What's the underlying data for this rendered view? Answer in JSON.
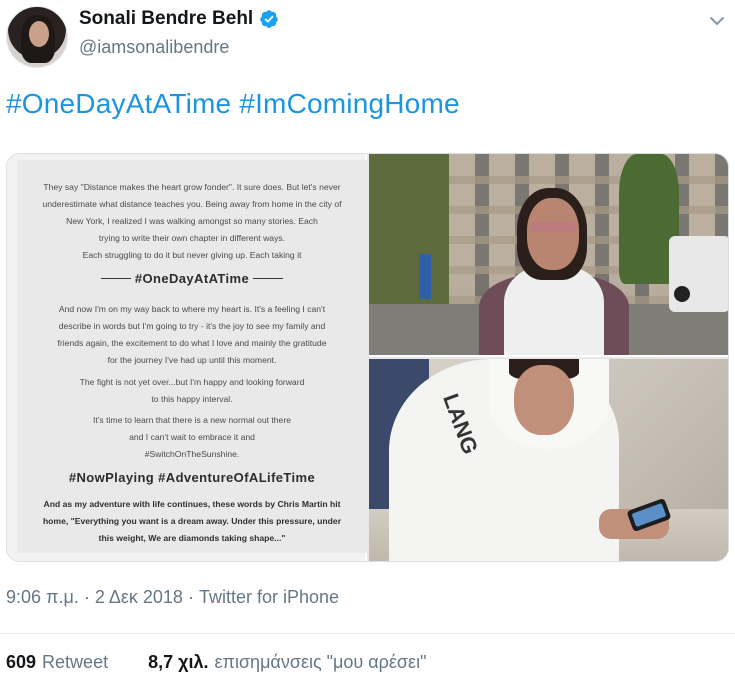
{
  "author": {
    "display_name": "Sonali Bendre Behl",
    "handle": "@iamsonalibendre"
  },
  "tweet": {
    "text": "#OneDayAtATime #ImComingHome",
    "timestamp": "9:06 π.μ.",
    "date": "2 Δεκ 2018",
    "source": "Twitter for iPhone",
    "separator": " · "
  },
  "image_text": {
    "para1": [
      "They say \"Distance makes the heart grow fonder\". It sure does. But let's never",
      "underestimate what distance teaches you. Being away from home in the city of",
      "New York, I realized I was walking amongst so many stories. Each",
      "trying to write their own chapter in different ways.",
      "Each struggling to do it but never giving up. Each taking it"
    ],
    "heading1": "#OneDayAtATime",
    "para2": [
      "And now I'm on my way back to where my heart is. It's a feeling I can't",
      "describe in words but I'm going to try - it's the joy to see my family and",
      "friends again, the excitement to do what I love and mainly the gratitude",
      "for the journey I've had up until this moment."
    ],
    "para3": [
      "The fight is not yet over...but I'm happy and looking forward",
      "to this happy interval."
    ],
    "para4": [
      "It's time to learn that there is a new normal out there",
      "and I can't wait to embrace it and",
      "#SwitchOnTheSunshine."
    ],
    "heading2": "#NowPlaying #AdventureOfALifeTime",
    "para5": [
      "And as my adventure with life continues, these words by Chris Martin hit",
      "home, \"Everything you want is a dream away. Under this pressure, under",
      "this weight, We are diamonds taking shape...\""
    ]
  },
  "hoodie_text": "LANG",
  "stats": {
    "retweets_count": "609",
    "retweets_label": "Retweet",
    "likes_count": "8,7 χιλ.",
    "likes_label": "επισημάνσεις \"μου αρέσει\""
  },
  "colors": {
    "link": "#1b95e0",
    "verified": "#1da1f2",
    "secondary_text": "#657786"
  },
  "icons": [
    "verified-badge-icon",
    "chevron-down-icon"
  ]
}
